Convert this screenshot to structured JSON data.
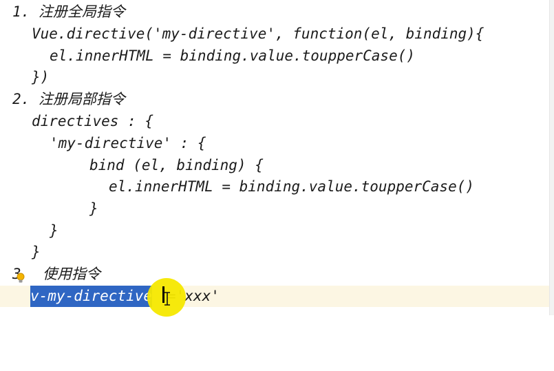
{
  "code": {
    "line1": "1. 注册全局指令",
    "line2": "Vue.directive('my-directive', function(el, binding){",
    "line3": "el.innerHTML = binding.value.toupperCase()",
    "line4": "})",
    "line5": "2. 注册局部指令",
    "line6": "directives : {",
    "line7": "'my-directive' : {",
    "line8": "bind (el, binding) {",
    "line9": "el.innerHTML = binding.value.toupperCase()",
    "line10": "}",
    "line11": "}",
    "line12": "}",
    "line13_number": "3",
    "line13_text": "使用指令",
    "line14_selected": "v-my-directive",
    "line14_rest": "='xxx'"
  },
  "colors": {
    "selection": "#2f66c3",
    "current_line": "#fcf6e3",
    "cursor_highlight": "#f5e800",
    "text": "#1b1b1b"
  },
  "icons": {
    "intention_bulb": "lightbulb-icon",
    "text_cursor": "ibeam-cursor-icon"
  }
}
